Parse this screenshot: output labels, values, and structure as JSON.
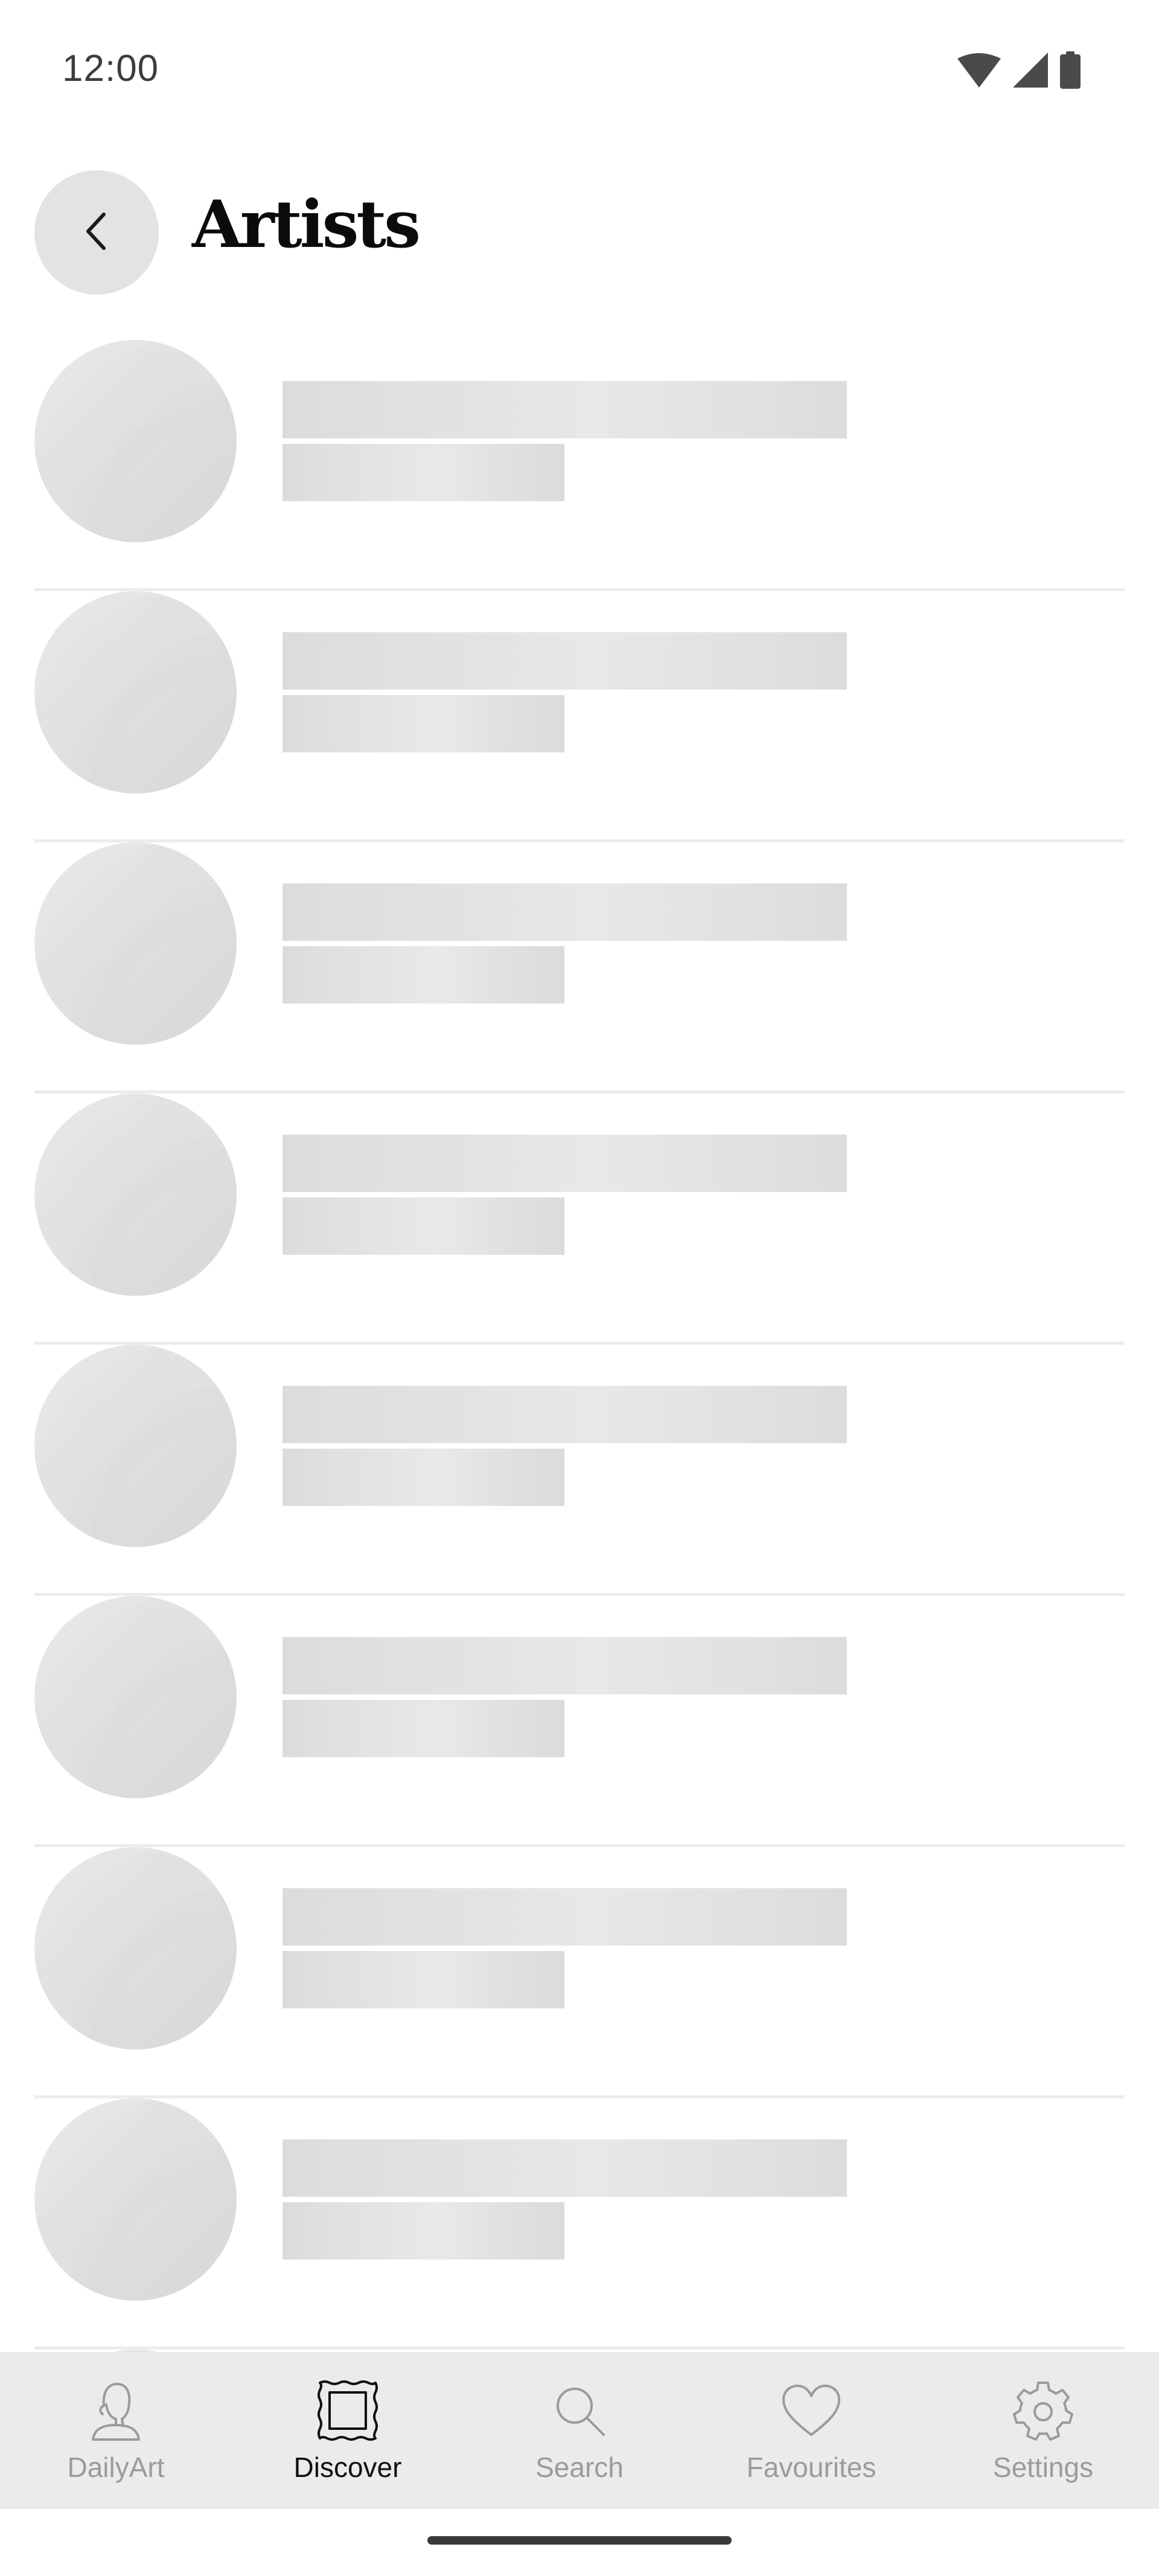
{
  "status_bar": {
    "time": "12:00",
    "icons": [
      "wifi-icon",
      "cell-signal-icon",
      "battery-icon"
    ]
  },
  "header": {
    "back_icon": "chevron-left-icon",
    "title": "Artists"
  },
  "artist_list": {
    "state": "loading",
    "placeholder_count": 9
  },
  "bottom_nav": {
    "items": [
      {
        "label": "DailyArt",
        "icon": "bust-statue-icon",
        "active": false
      },
      {
        "label": "Discover",
        "icon": "picture-frame-icon",
        "active": true
      },
      {
        "label": "Search",
        "icon": "search-icon",
        "active": false
      },
      {
        "label": "Favourites",
        "icon": "heart-icon",
        "active": false
      },
      {
        "label": "Settings",
        "icon": "gear-icon",
        "active": false
      }
    ]
  },
  "colors": {
    "background": "#ffffff",
    "placeholder": "#dedee0",
    "back_button": "#e3e3e4",
    "nav_background": "#ebebec",
    "nav_active": "#111111",
    "nav_inactive": "#9b9b9b"
  }
}
